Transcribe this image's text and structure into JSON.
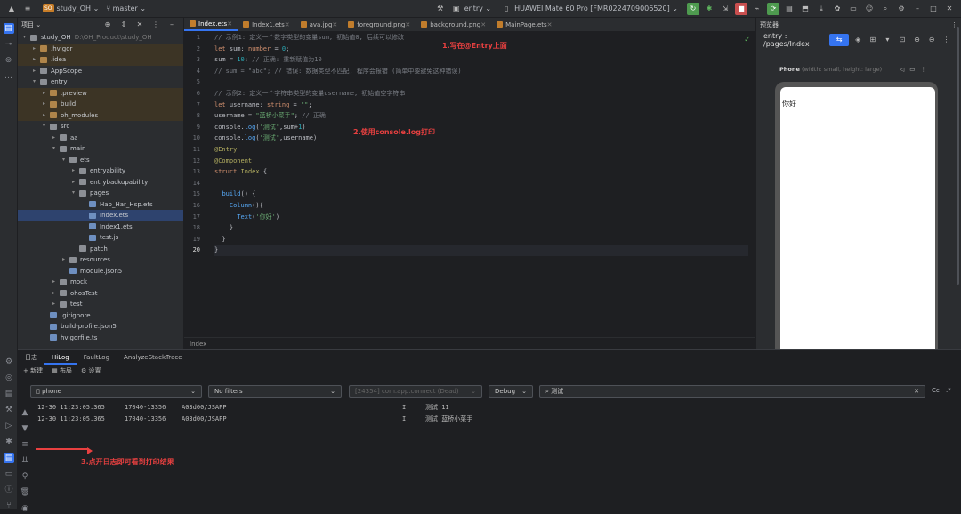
{
  "topbar": {
    "project_badge": "SO",
    "project_name": "study_OH",
    "branch": "master",
    "run_config": "entry",
    "device": "HUAWEI Mate 60 Pro [FMR0224709006520]"
  },
  "project_panel": {
    "title": "项目",
    "items": [
      {
        "label": "study_OH",
        "extra": "D:\\OH_Product\\study_OH",
        "indent": 0,
        "open": true,
        "kind": "folder",
        "state": ""
      },
      {
        "label": ".hvigor",
        "indent": 1,
        "open": false,
        "kind": "folderO",
        "state": "hl"
      },
      {
        "label": ".idea",
        "indent": 1,
        "open": false,
        "kind": "folderO",
        "state": "hl"
      },
      {
        "label": "AppScope",
        "indent": 1,
        "open": false,
        "kind": "folder",
        "state": ""
      },
      {
        "label": "entry",
        "indent": 1,
        "open": true,
        "kind": "folder",
        "state": ""
      },
      {
        "label": ".preview",
        "indent": 2,
        "open": false,
        "kind": "folderO",
        "state": "hl"
      },
      {
        "label": "build",
        "indent": 2,
        "open": false,
        "kind": "folderO",
        "state": "hl"
      },
      {
        "label": "oh_modules",
        "indent": 2,
        "open": false,
        "kind": "folderO",
        "state": "hl"
      },
      {
        "label": "src",
        "indent": 2,
        "open": true,
        "kind": "folder",
        "state": ""
      },
      {
        "label": "aa",
        "indent": 3,
        "open": false,
        "kind": "folder",
        "state": ""
      },
      {
        "label": "main",
        "indent": 3,
        "open": true,
        "kind": "folder",
        "state": ""
      },
      {
        "label": "ets",
        "indent": 4,
        "open": true,
        "kind": "folder",
        "state": ""
      },
      {
        "label": "entryability",
        "indent": 5,
        "open": false,
        "kind": "folder",
        "state": ""
      },
      {
        "label": "entrybackupability",
        "indent": 5,
        "open": false,
        "kind": "folder",
        "state": ""
      },
      {
        "label": "pages",
        "indent": 5,
        "open": true,
        "kind": "folder",
        "state": ""
      },
      {
        "label": "Hap_Har_Hsp.ets",
        "indent": 6,
        "open": null,
        "kind": "file",
        "state": ""
      },
      {
        "label": "Index.ets",
        "indent": 6,
        "open": null,
        "kind": "file",
        "state": "sel"
      },
      {
        "label": "Index1.ets",
        "indent": 6,
        "open": null,
        "kind": "file",
        "state": ""
      },
      {
        "label": "test.js",
        "indent": 6,
        "open": null,
        "kind": "file",
        "state": ""
      },
      {
        "label": "patch",
        "indent": 5,
        "open": null,
        "kind": "folder",
        "state": ""
      },
      {
        "label": "resources",
        "indent": 4,
        "open": false,
        "kind": "folder",
        "state": ""
      },
      {
        "label": "module.json5",
        "indent": 4,
        "open": null,
        "kind": "file",
        "state": ""
      },
      {
        "label": "mock",
        "indent": 3,
        "open": false,
        "kind": "folder",
        "state": ""
      },
      {
        "label": "ohosTest",
        "indent": 3,
        "open": false,
        "kind": "folder",
        "state": ""
      },
      {
        "label": "test",
        "indent": 3,
        "open": false,
        "kind": "folder",
        "state": ""
      },
      {
        "label": ".gitignore",
        "indent": 2,
        "open": null,
        "kind": "file",
        "state": ""
      },
      {
        "label": "build-profile.json5",
        "indent": 2,
        "open": null,
        "kind": "file",
        "state": ""
      },
      {
        "label": "hvigorfile.ts",
        "indent": 2,
        "open": null,
        "kind": "file",
        "state": ""
      }
    ]
  },
  "editor": {
    "tabs": [
      {
        "label": "Index.ets",
        "active": true
      },
      {
        "label": "Index1.ets",
        "active": false
      },
      {
        "label": "ava.jpg",
        "active": false
      },
      {
        "label": "foreground.png",
        "active": false
      },
      {
        "label": "background.png",
        "active": false
      },
      {
        "label": "MainPage.ets",
        "active": false
      }
    ],
    "lines": [
      [
        [
          "cm",
          "// 示例1: 定义一个数字类型的变量sum, 初始值0, 后续可以修改"
        ]
      ],
      [
        [
          "kw",
          "let "
        ],
        [
          "",
          "sum: "
        ],
        [
          "kw",
          "number"
        ],
        [
          "",
          " = "
        ],
        [
          "num",
          "0"
        ],
        [
          "",
          ";"
        ]
      ],
      [
        [
          "",
          "sum = "
        ],
        [
          "num",
          "10"
        ],
        [
          "",
          "; "
        ],
        [
          "cm",
          "// 正确: 重新赋值为10"
        ]
      ],
      [
        [
          "cm",
          "// sum = \"abc\"; // 错误: 数据类型不匹配, 程序会报错 (简单中要避免这种错误)"
        ]
      ],
      [
        [
          "",
          ""
        ]
      ],
      [
        [
          "cm",
          "// 示例2: 定义一个字符串类型的变量username, 初始值空字符串"
        ]
      ],
      [
        [
          "kw",
          "let "
        ],
        [
          "",
          "username: "
        ],
        [
          "kw",
          "string"
        ],
        [
          "",
          " = "
        ],
        [
          "str",
          "\"\""
        ],
        [
          "",
          ";"
        ]
      ],
      [
        [
          "",
          "username = "
        ],
        [
          "str",
          "\"蓝桥小菜手\""
        ],
        [
          "",
          "; "
        ],
        [
          "cm",
          "// 正确"
        ]
      ],
      [
        [
          "",
          "console."
        ],
        [
          "fn",
          "log"
        ],
        [
          "",
          "("
        ],
        [
          "str",
          "'测试'"
        ],
        [
          "",
          ",sum+"
        ],
        [
          "num",
          "1"
        ],
        [
          "",
          ")"
        ]
      ],
      [
        [
          "",
          "console."
        ],
        [
          "fn",
          "log"
        ],
        [
          "",
          "("
        ],
        [
          "str",
          "'测试'"
        ],
        [
          "",
          ",username)"
        ]
      ],
      [
        [
          "dec",
          "@Entry"
        ]
      ],
      [
        [
          "dec",
          "@Component"
        ]
      ],
      [
        [
          "kw",
          "struct "
        ],
        [
          "cls",
          "Index "
        ],
        [
          "",
          "{"
        ]
      ],
      [
        [
          "",
          ""
        ]
      ],
      [
        [
          "",
          "  "
        ],
        [
          "fn",
          "build"
        ],
        [
          "",
          "() {"
        ]
      ],
      [
        [
          "",
          "    "
        ],
        [
          "fn",
          "Column"
        ],
        [
          "",
          "(){"
        ]
      ],
      [
        [
          "",
          "      "
        ],
        [
          "fn",
          "Text"
        ],
        [
          "",
          "("
        ],
        [
          "str",
          "'你好'"
        ],
        [
          "",
          ")"
        ]
      ],
      [
        [
          "",
          "    }"
        ]
      ],
      [
        [
          "",
          "  }"
        ]
      ],
      [
        [
          "",
          "}"
        ]
      ]
    ],
    "annotations": {
      "note1": "1.写在@Entry上面",
      "note2": "2.使用console.log打印"
    },
    "breadcrumb": "Index"
  },
  "preview": {
    "title": "预览器",
    "route": "entry : /pages/Index",
    "device_label": "Phone",
    "device_detail": "(width: small, height: large)",
    "screen_text": "你好"
  },
  "bottom": {
    "tabs": [
      {
        "label": "日志",
        "active": false
      },
      {
        "label": "HiLog",
        "active": true
      },
      {
        "label": "FaultLog",
        "active": false
      },
      {
        "label": "AnalyzeStackTrace",
        "active": false
      }
    ],
    "toolbar": {
      "new": "新建",
      "layout": "布局",
      "settings": "设置"
    },
    "device_select": "phone",
    "filter_select": "No filters",
    "process_select": "[24354] com.app.connect (Dead)",
    "level_select": "Debug",
    "search_value": "测试",
    "logs": [
      {
        "time": "12-30 11:23:05.365",
        "pid": "17040-13356",
        "tag": "A03d00/JSAPP",
        "level": "I",
        "msg": "测试 11"
      },
      {
        "time": "12-30 11:23:05.365",
        "pid": "17040-13356",
        "tag": "A03d00/JSAPP",
        "level": "I",
        "msg": "测试 蓝桥小菜手"
      }
    ],
    "note3": "3.点开日志即可看到打印结果"
  }
}
